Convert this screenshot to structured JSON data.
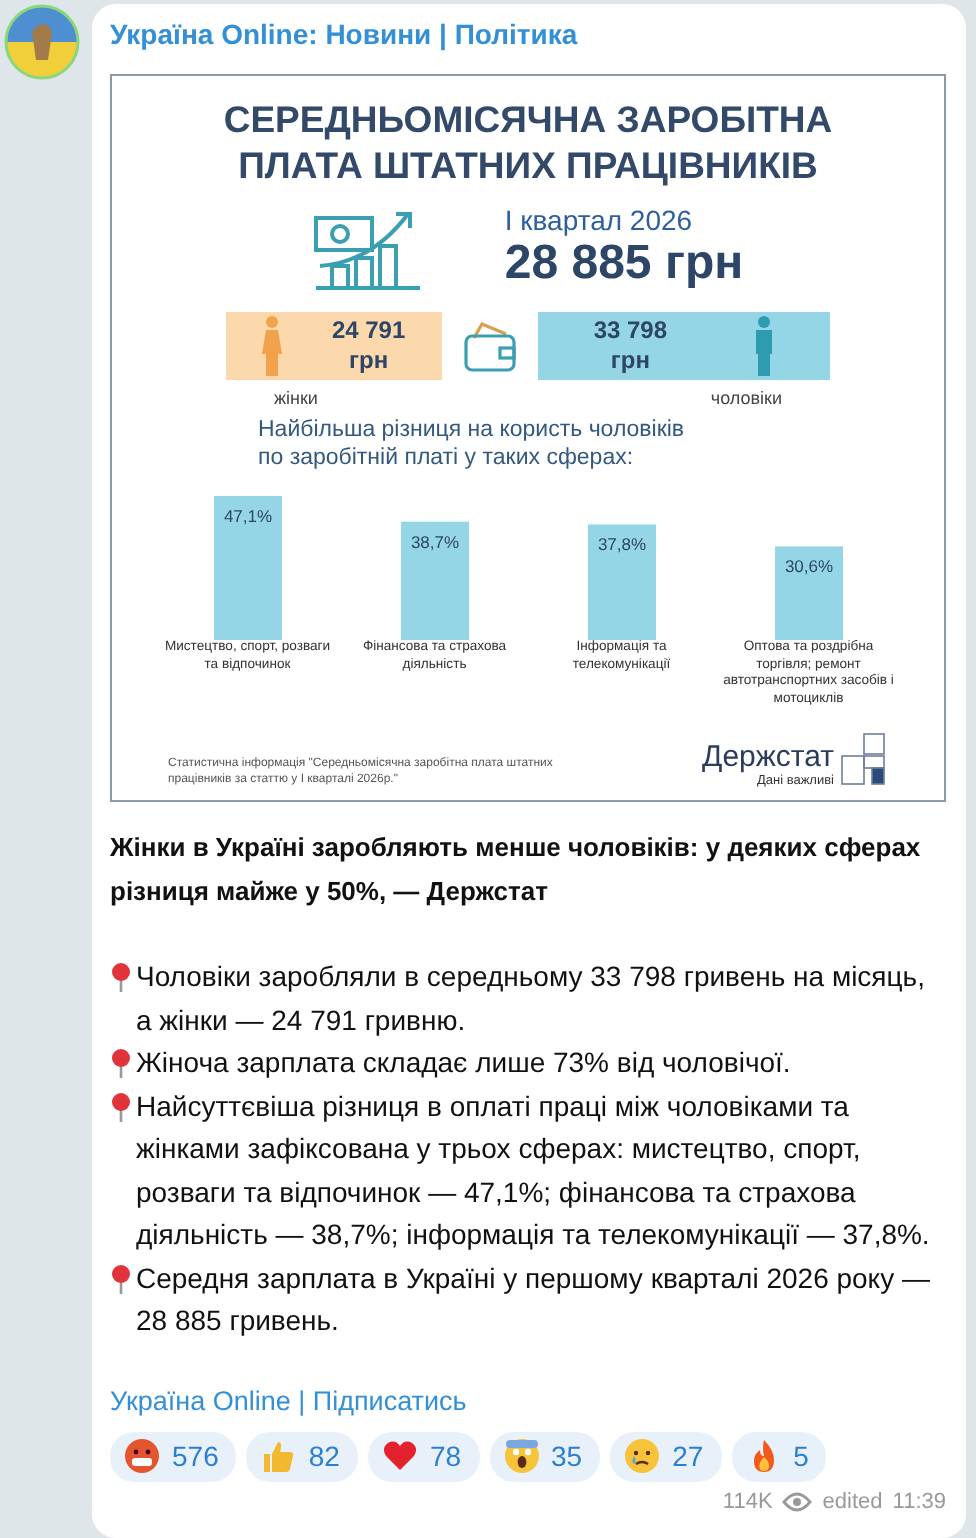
{
  "channel": {
    "title": "Україна Online: Новини | Політика"
  },
  "infographic": {
    "title_lines": [
      "СЕРЕДНЬОМІСЯЧНА ЗАРОБІТНА",
      "ПЛАТА ШТАТНИХ ПРАЦІВНИКІВ"
    ],
    "period": "І квартал 2026",
    "total": "28 885 грн",
    "women": {
      "amount": "24 791",
      "unit": "грн",
      "label": "жінки"
    },
    "men": {
      "amount": "33 798",
      "unit": "грн",
      "label": "чоловіки"
    },
    "subtitle_lines": [
      "Найбільша різниця на користь чоловіків",
      "по заробітній платі у таких сферах:"
    ],
    "chart_data": {
      "type": "bar",
      "categories": [
        "Мистецтво, спорт, розваги та відпочинок",
        "Фінансова та страхова діяльність",
        "Інформація та телекомунікації",
        "Оптова та роздрібна торгівля; ремонт автотранспортних засобів і мотоциклів"
      ],
      "values": [
        47.1,
        38.7,
        37.8,
        30.6
      ],
      "value_labels": [
        "47,1%",
        "38,7%",
        "37,8%",
        "30,6%"
      ]
    },
    "footnote": "Статистична інформація \"Середньомісячна заробітна плата штатних працівників за статтю у І кварталі 2026р.\"",
    "logo_name": "Держстат",
    "logo_tagline": "Дані важливі"
  },
  "post": {
    "headline": "Жінки в Україні заробляють менше чоловіків: у деяких сферах різниця майже у 50%, — Держстат",
    "bullets": [
      "Чоловіки заробляли в середньому 33 798 гривень на місяць, а жінки — 24 791 гривню.",
      "Жіноча зарплата складає лише 73% від чоловічої.",
      "Найсуттєвіша різниця в оплаті праці між чоловіками та жінками зафіксована у трьох сферах: мистецтво, спорт, розваги та відпочинок — 47,1%; фінансова та страхова діяльність — 38,7%; інформація та телекомунікації — 37,8%.",
      "Середня зарплата в Україні у першому кварталі 2026 року — 28 885 гривень."
    ],
    "footer_link": "Україна Online | Підписатись"
  },
  "reactions": [
    {
      "kind": "angry",
      "count": "576"
    },
    {
      "kind": "thumbs",
      "count": "82"
    },
    {
      "kind": "heart",
      "count": "78"
    },
    {
      "kind": "scream",
      "count": "35"
    },
    {
      "kind": "cry",
      "count": "27"
    },
    {
      "kind": "fire",
      "count": "5"
    }
  ],
  "meta": {
    "views": "114K",
    "edited": "edited",
    "time": "11:39"
  }
}
